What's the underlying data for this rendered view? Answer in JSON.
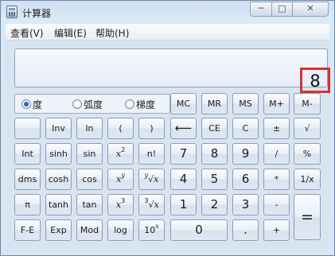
{
  "window": {
    "title": "计算器",
    "min_glyph": "─",
    "max_glyph": "□",
    "close_glyph": "✕"
  },
  "menu": [
    "查看(V)",
    "编辑(E)",
    "帮助(H)"
  ],
  "display": {
    "value": "8"
  },
  "angle_modes": [
    {
      "label": "度",
      "selected": true
    },
    {
      "label": "弧度",
      "selected": false
    },
    {
      "label": "梯度",
      "selected": false
    }
  ],
  "memory_row": [
    "MC",
    "MR",
    "MS",
    "M+",
    "M-"
  ],
  "sci": {
    "r1": [
      "",
      "Inv",
      "ln",
      "(",
      ")"
    ],
    "r2": [
      "Int",
      "sinh",
      "sin",
      "",
      "n!"
    ],
    "r3": [
      "dms",
      "cosh",
      "cos",
      "",
      ""
    ],
    "r4": [
      "π",
      "tanh",
      "tan",
      "",
      ""
    ],
    "r5": [
      "F-E",
      "Exp",
      "Mod",
      "log",
      ""
    ],
    "x2_base": "x",
    "x2_exp": "2",
    "xy_base": "x",
    "xy_exp": "y",
    "x3_base": "x",
    "x3_exp": "3",
    "yroot_idx": "y",
    "yroot_body": "√x",
    "croot_idx": "3",
    "croot_body": "√x",
    "tenx_base": "10",
    "tenx_exp": "x"
  },
  "std": {
    "r1": [
      "⟵",
      "CE",
      "C",
      "±",
      "√"
    ],
    "r2": [
      "7",
      "8",
      "9",
      "/",
      "%"
    ],
    "r3": [
      "4",
      "5",
      "6",
      "*",
      "1/x"
    ],
    "r4": [
      "1",
      "2",
      "3",
      "-",
      "="
    ],
    "r5": [
      "0",
      ".",
      "+"
    ]
  }
}
